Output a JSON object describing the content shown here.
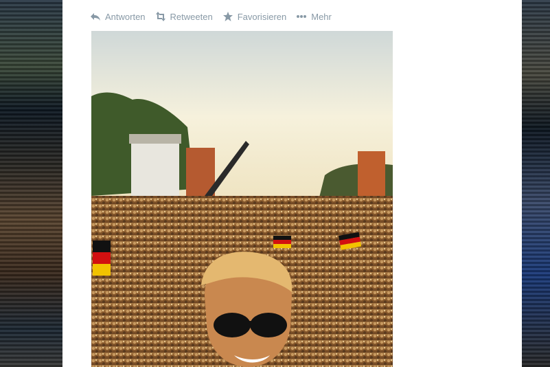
{
  "tweet": {
    "actions": [
      {
        "label": "Antworten",
        "icon": "reply-icon"
      },
      {
        "label": "Retweeten",
        "icon": "retweet-icon"
      },
      {
        "label": "Favorisieren",
        "icon": "star-icon"
      },
      {
        "label": "Mehr",
        "icon": "more-icon"
      }
    ]
  },
  "colors": {
    "action_text": "#8899a6",
    "card_bg": "#ffffff",
    "flag_black": "#111111",
    "flag_red": "#d21010",
    "flag_gold": "#f2c200"
  }
}
